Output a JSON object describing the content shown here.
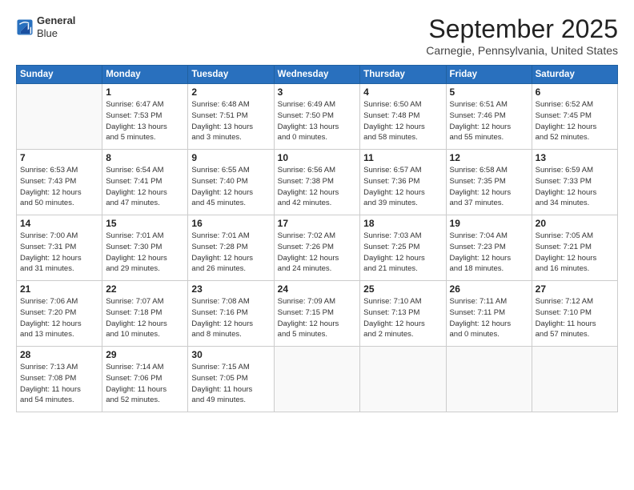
{
  "logo": {
    "line1": "General",
    "line2": "Blue"
  },
  "title": "September 2025",
  "location": "Carnegie, Pennsylvania, United States",
  "days_header": [
    "Sunday",
    "Monday",
    "Tuesday",
    "Wednesday",
    "Thursday",
    "Friday",
    "Saturday"
  ],
  "weeks": [
    [
      {
        "num": "",
        "info": ""
      },
      {
        "num": "1",
        "info": "Sunrise: 6:47 AM\nSunset: 7:53 PM\nDaylight: 13 hours\nand 5 minutes."
      },
      {
        "num": "2",
        "info": "Sunrise: 6:48 AM\nSunset: 7:51 PM\nDaylight: 13 hours\nand 3 minutes."
      },
      {
        "num": "3",
        "info": "Sunrise: 6:49 AM\nSunset: 7:50 PM\nDaylight: 13 hours\nand 0 minutes."
      },
      {
        "num": "4",
        "info": "Sunrise: 6:50 AM\nSunset: 7:48 PM\nDaylight: 12 hours\nand 58 minutes."
      },
      {
        "num": "5",
        "info": "Sunrise: 6:51 AM\nSunset: 7:46 PM\nDaylight: 12 hours\nand 55 minutes."
      },
      {
        "num": "6",
        "info": "Sunrise: 6:52 AM\nSunset: 7:45 PM\nDaylight: 12 hours\nand 52 minutes."
      }
    ],
    [
      {
        "num": "7",
        "info": "Sunrise: 6:53 AM\nSunset: 7:43 PM\nDaylight: 12 hours\nand 50 minutes."
      },
      {
        "num": "8",
        "info": "Sunrise: 6:54 AM\nSunset: 7:41 PM\nDaylight: 12 hours\nand 47 minutes."
      },
      {
        "num": "9",
        "info": "Sunrise: 6:55 AM\nSunset: 7:40 PM\nDaylight: 12 hours\nand 45 minutes."
      },
      {
        "num": "10",
        "info": "Sunrise: 6:56 AM\nSunset: 7:38 PM\nDaylight: 12 hours\nand 42 minutes."
      },
      {
        "num": "11",
        "info": "Sunrise: 6:57 AM\nSunset: 7:36 PM\nDaylight: 12 hours\nand 39 minutes."
      },
      {
        "num": "12",
        "info": "Sunrise: 6:58 AM\nSunset: 7:35 PM\nDaylight: 12 hours\nand 37 minutes."
      },
      {
        "num": "13",
        "info": "Sunrise: 6:59 AM\nSunset: 7:33 PM\nDaylight: 12 hours\nand 34 minutes."
      }
    ],
    [
      {
        "num": "14",
        "info": "Sunrise: 7:00 AM\nSunset: 7:31 PM\nDaylight: 12 hours\nand 31 minutes."
      },
      {
        "num": "15",
        "info": "Sunrise: 7:01 AM\nSunset: 7:30 PM\nDaylight: 12 hours\nand 29 minutes."
      },
      {
        "num": "16",
        "info": "Sunrise: 7:01 AM\nSunset: 7:28 PM\nDaylight: 12 hours\nand 26 minutes."
      },
      {
        "num": "17",
        "info": "Sunrise: 7:02 AM\nSunset: 7:26 PM\nDaylight: 12 hours\nand 24 minutes."
      },
      {
        "num": "18",
        "info": "Sunrise: 7:03 AM\nSunset: 7:25 PM\nDaylight: 12 hours\nand 21 minutes."
      },
      {
        "num": "19",
        "info": "Sunrise: 7:04 AM\nSunset: 7:23 PM\nDaylight: 12 hours\nand 18 minutes."
      },
      {
        "num": "20",
        "info": "Sunrise: 7:05 AM\nSunset: 7:21 PM\nDaylight: 12 hours\nand 16 minutes."
      }
    ],
    [
      {
        "num": "21",
        "info": "Sunrise: 7:06 AM\nSunset: 7:20 PM\nDaylight: 12 hours\nand 13 minutes."
      },
      {
        "num": "22",
        "info": "Sunrise: 7:07 AM\nSunset: 7:18 PM\nDaylight: 12 hours\nand 10 minutes."
      },
      {
        "num": "23",
        "info": "Sunrise: 7:08 AM\nSunset: 7:16 PM\nDaylight: 12 hours\nand 8 minutes."
      },
      {
        "num": "24",
        "info": "Sunrise: 7:09 AM\nSunset: 7:15 PM\nDaylight: 12 hours\nand 5 minutes."
      },
      {
        "num": "25",
        "info": "Sunrise: 7:10 AM\nSunset: 7:13 PM\nDaylight: 12 hours\nand 2 minutes."
      },
      {
        "num": "26",
        "info": "Sunrise: 7:11 AM\nSunset: 7:11 PM\nDaylight: 12 hours\nand 0 minutes."
      },
      {
        "num": "27",
        "info": "Sunrise: 7:12 AM\nSunset: 7:10 PM\nDaylight: 11 hours\nand 57 minutes."
      }
    ],
    [
      {
        "num": "28",
        "info": "Sunrise: 7:13 AM\nSunset: 7:08 PM\nDaylight: 11 hours\nand 54 minutes."
      },
      {
        "num": "29",
        "info": "Sunrise: 7:14 AM\nSunset: 7:06 PM\nDaylight: 11 hours\nand 52 minutes."
      },
      {
        "num": "30",
        "info": "Sunrise: 7:15 AM\nSunset: 7:05 PM\nDaylight: 11 hours\nand 49 minutes."
      },
      {
        "num": "",
        "info": ""
      },
      {
        "num": "",
        "info": ""
      },
      {
        "num": "",
        "info": ""
      },
      {
        "num": "",
        "info": ""
      }
    ]
  ]
}
